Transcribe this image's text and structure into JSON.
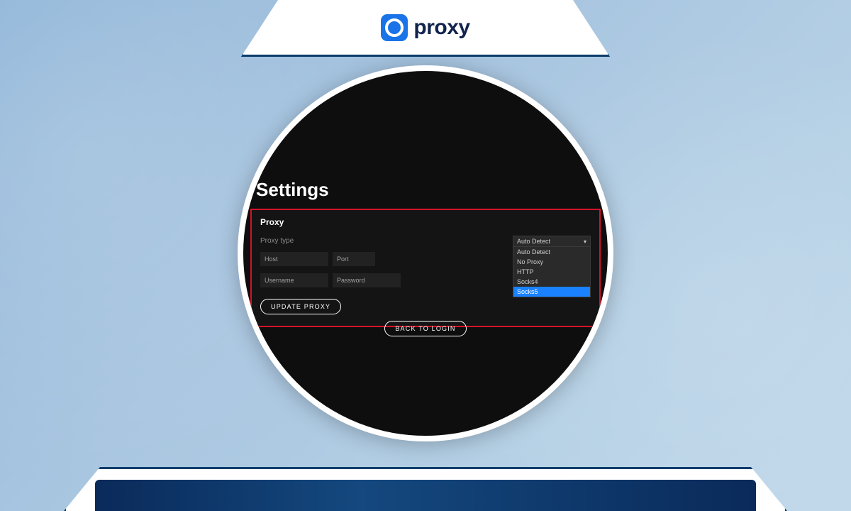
{
  "brand": {
    "name": "proxy"
  },
  "settings": {
    "title": "Settings",
    "sectionTitle": "Proxy",
    "proxyTypeLabel": "Proxy type",
    "hostPlaceholder": "Host",
    "portPlaceholder": "Port",
    "usernamePlaceholder": "Username",
    "passwordPlaceholder": "Password",
    "updateButton": "Update Proxy",
    "backButton": "Back to Login",
    "dropdown": {
      "selected": "Auto Detect",
      "options": [
        "Auto Detect",
        "No Proxy",
        "HTTP",
        "Socks4",
        "Socks5"
      ],
      "highlighted": "Socks5"
    }
  }
}
